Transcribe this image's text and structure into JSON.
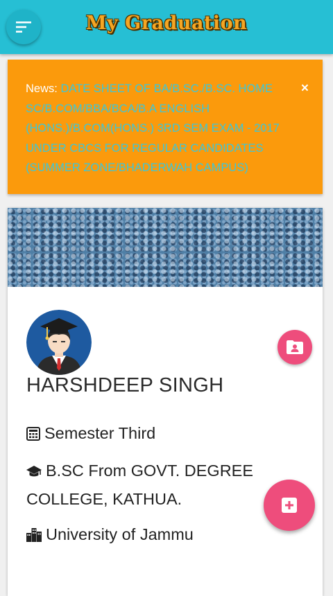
{
  "app": {
    "title": "My Graduation",
    "accent_color": "#26bfd4",
    "menu_icon": "menu-icon"
  },
  "news": {
    "label": "News:",
    "text": "DATE SHEET OF BA/B.SC./B.SC. HOME SC/B.COM/BBA/BCA/B.A ENGLISH (HONS.)/B.COM(HONS.) 3RD SEM EXAM - 2017 UNDER CBCS FOR REGULAR CANDIDATES (SUMMER ZONE/BHADERWAH CAMPUS)",
    "close": "×",
    "background_color": "#fb9a0c",
    "text_color": "#3cc7d9"
  },
  "profile": {
    "name": "HARSHDEEP SINGH",
    "semester": "Semester Third",
    "course": "B.SC From GOVT. DEGREE COLLEGE, KATHUA.",
    "university": "University of Jammu",
    "semester_icon": "calculator-icon",
    "course_icon": "graduation-cap-icon",
    "university_icon": "city-icon",
    "fab_color": "#ee4d7c"
  }
}
